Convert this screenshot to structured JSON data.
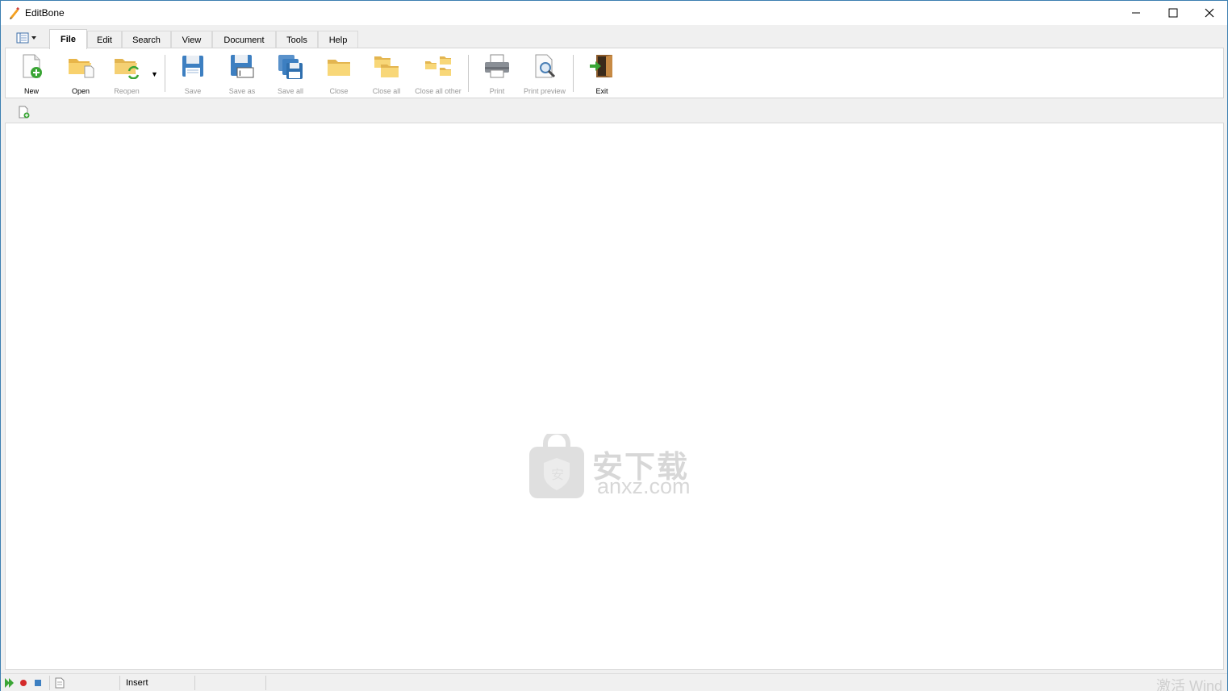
{
  "window": {
    "title": "EditBone",
    "controls": {
      "minimize": "minimize-icon",
      "maximize": "maximize-icon",
      "close": "close-icon"
    }
  },
  "ribbon": {
    "tabs": [
      {
        "label": "File",
        "active": true
      },
      {
        "label": "Edit",
        "active": false
      },
      {
        "label": "Search",
        "active": false
      },
      {
        "label": "View",
        "active": false
      },
      {
        "label": "Document",
        "active": false
      },
      {
        "label": "Tools",
        "active": false
      },
      {
        "label": "Help",
        "active": false
      }
    ],
    "buttons": [
      {
        "label": "New",
        "icon": "new-file-icon",
        "enabled": true
      },
      {
        "label": "Open",
        "icon": "open-folder-icon",
        "enabled": true
      },
      {
        "label": "Reopen",
        "icon": "reopen-icon",
        "enabled": false
      },
      {
        "label": "Save",
        "icon": "save-icon",
        "enabled": false
      },
      {
        "label": "Save as",
        "icon": "save-as-icon",
        "enabled": false
      },
      {
        "label": "Save all",
        "icon": "save-all-icon",
        "enabled": false
      },
      {
        "label": "Close",
        "icon": "close-folder-icon",
        "enabled": false
      },
      {
        "label": "Close all",
        "icon": "close-all-icon",
        "enabled": false
      },
      {
        "label": "Close all other",
        "icon": "close-all-other-icon",
        "enabled": false
      },
      {
        "label": "Print",
        "icon": "printer-icon",
        "enabled": false
      },
      {
        "label": "Print preview",
        "icon": "print-preview-icon",
        "enabled": false
      },
      {
        "label": "Exit",
        "icon": "exit-door-icon",
        "enabled": true
      }
    ]
  },
  "watermark": {
    "chinese": "安下载",
    "domain": "anxz.com"
  },
  "statusbar": {
    "mode": "Insert",
    "activation_notice": "激活 Wind"
  },
  "colors": {
    "accent": "#3c7fb1",
    "folder": "#f5c85a",
    "save_blue": "#3d7fc1",
    "green": "#3aa535"
  }
}
